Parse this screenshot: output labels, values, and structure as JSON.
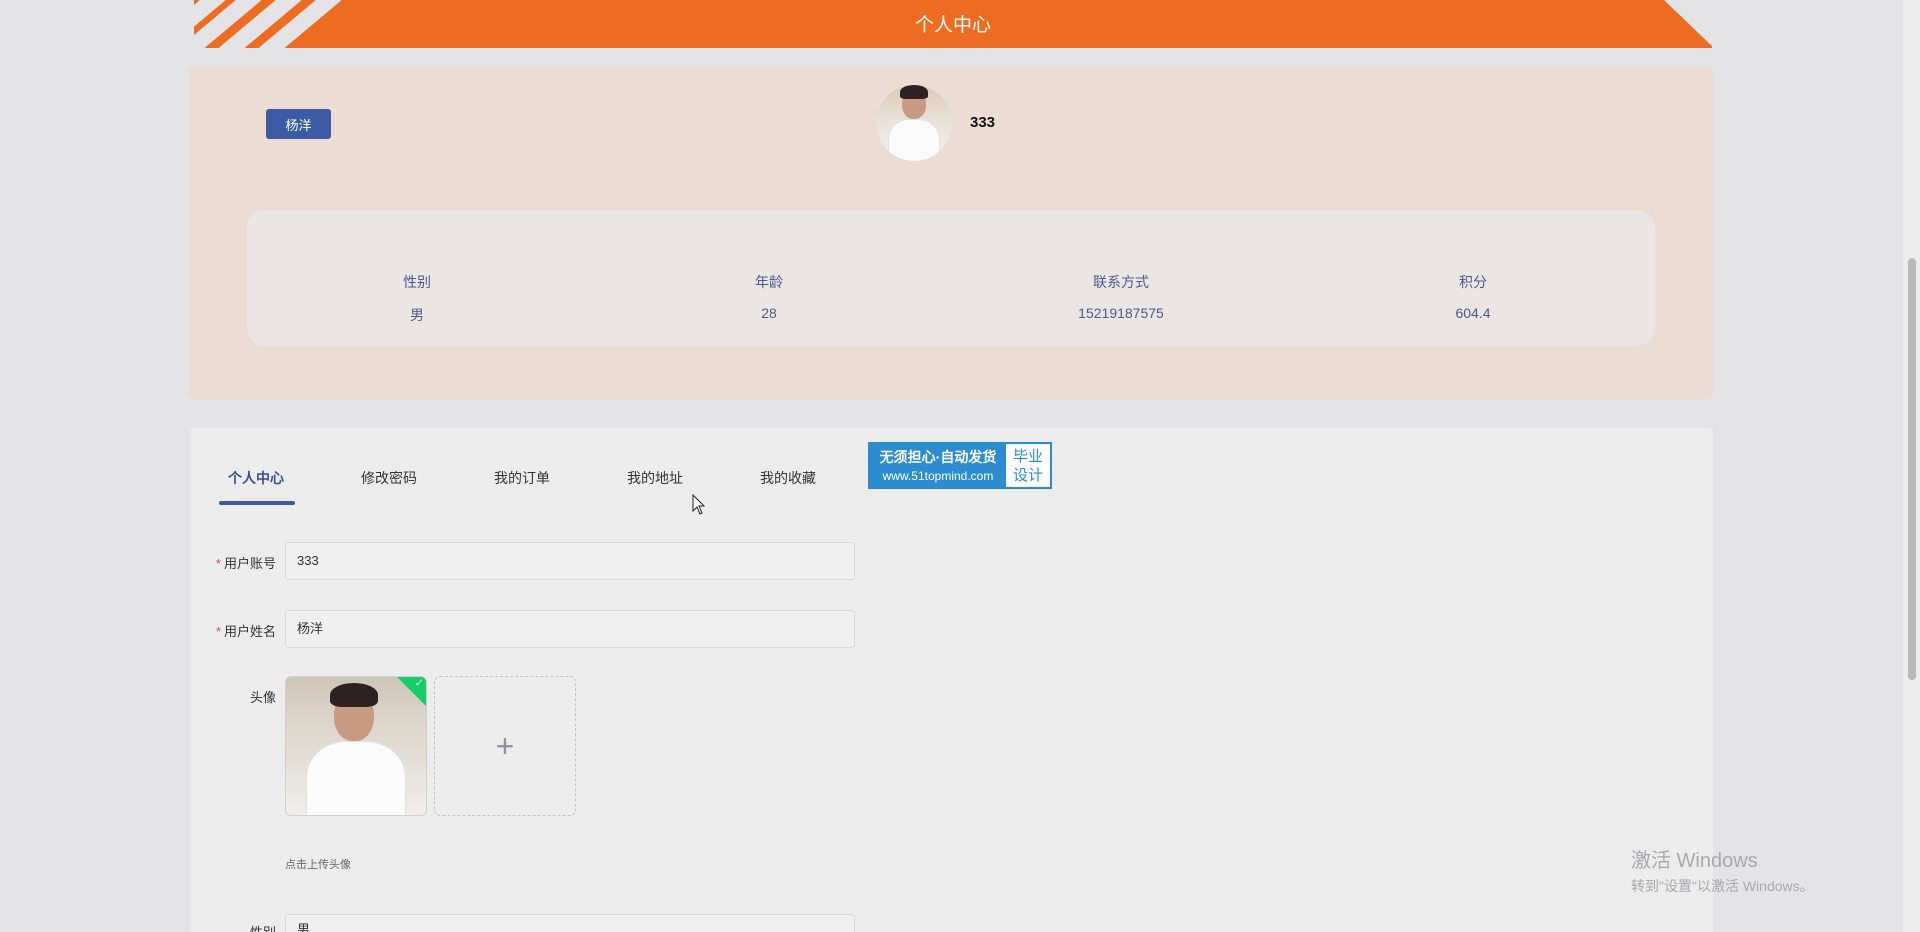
{
  "header": {
    "title": "个人中心"
  },
  "profile": {
    "name_badge": "杨洋",
    "account": "333",
    "stats": [
      {
        "label": "性别",
        "value": "男"
      },
      {
        "label": "年龄",
        "value": "28"
      },
      {
        "label": "联系方式",
        "value": "15219187575"
      },
      {
        "label": "积分",
        "value": "604.4"
      }
    ]
  },
  "tabs": [
    {
      "label": "个人中心",
      "active": true
    },
    {
      "label": "修改密码",
      "active": false
    },
    {
      "label": "我的订单",
      "active": false
    },
    {
      "label": "我的地址",
      "active": false
    },
    {
      "label": "我的收藏",
      "active": false
    }
  ],
  "promo": {
    "line1": "无须担心·自动发货",
    "line2": "www.51topmind.com",
    "right1": "毕业",
    "right2": "设计"
  },
  "form": {
    "account_label": "用户账号",
    "account_value": "333",
    "name_label": "用户姓名",
    "name_value": "杨洋",
    "avatar_label": "头像",
    "upload_plus": "+",
    "upload_tip": "点击上传头像",
    "gender_label": "性别",
    "gender_value": "男"
  },
  "watermark": {
    "line1": "激活 Windows",
    "line2": "转到\"设置\"以激活 Windows。"
  },
  "colors": {
    "banner": "#ee6b22",
    "accent": "#3b5ba5",
    "success": "#13ce66"
  }
}
